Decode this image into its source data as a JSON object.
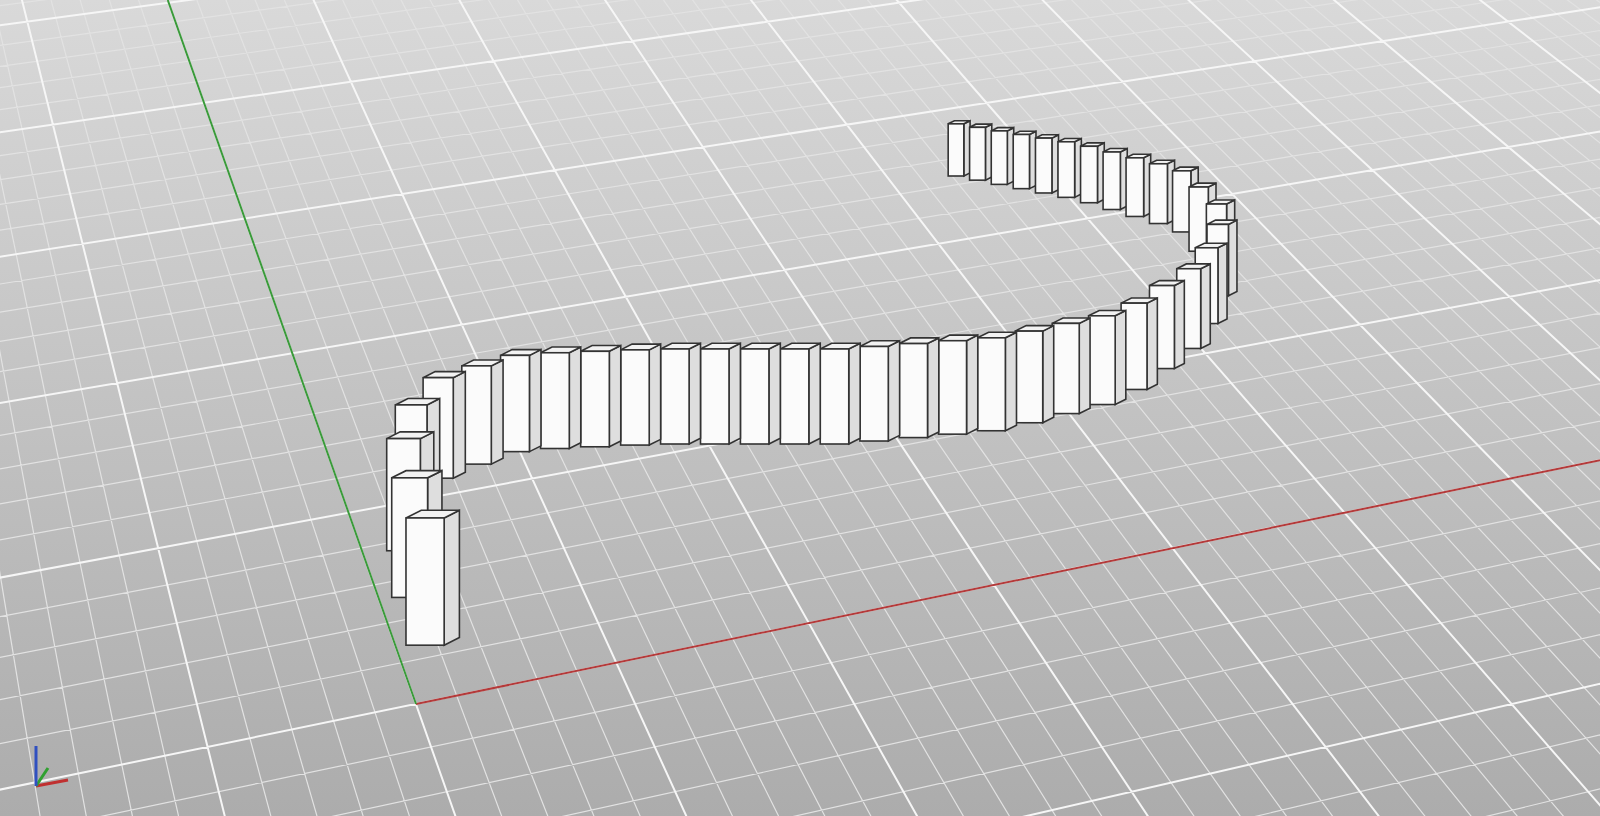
{
  "viewport": {
    "grid": true,
    "world_axes": true,
    "axis_icon": true
  }
}
